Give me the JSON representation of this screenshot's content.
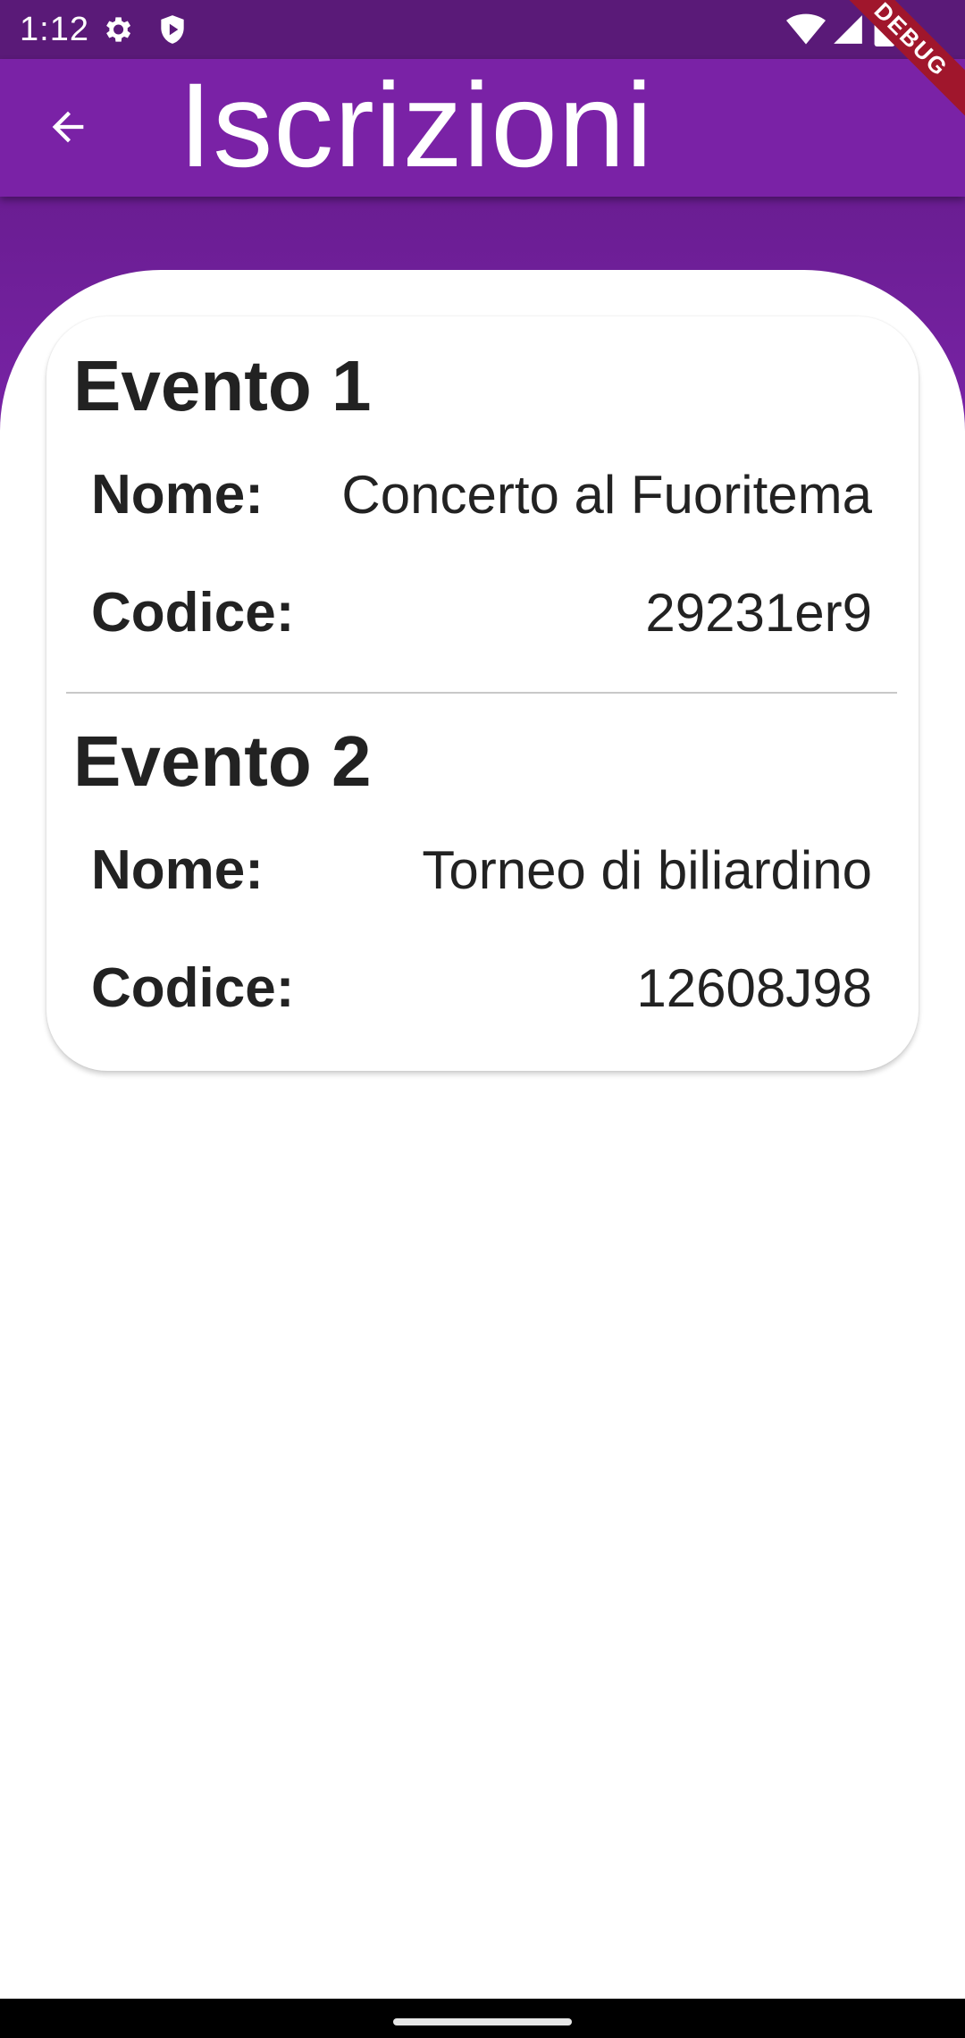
{
  "status_bar": {
    "time": "1:12",
    "icons": [
      "settings-icon",
      "shield-icon",
      "wifi-icon",
      "signal-icon",
      "battery-icon"
    ]
  },
  "app_bar": {
    "title": "Iscrizioni",
    "back_icon": "arrow-back-icon",
    "background_color": "#7a22a6"
  },
  "debug_banner": {
    "label": "DEBUG"
  },
  "events": [
    {
      "title": "Evento 1",
      "name_label": "Nome:",
      "name_value": "Concerto al Fuoritema",
      "code_label": "Codice:",
      "code_value": "29231er9"
    },
    {
      "title": "Evento 2",
      "name_label": "Nome:",
      "name_value": "Torneo di biliardino",
      "code_label": "Codice:",
      "code_value": "12608J98"
    }
  ]
}
